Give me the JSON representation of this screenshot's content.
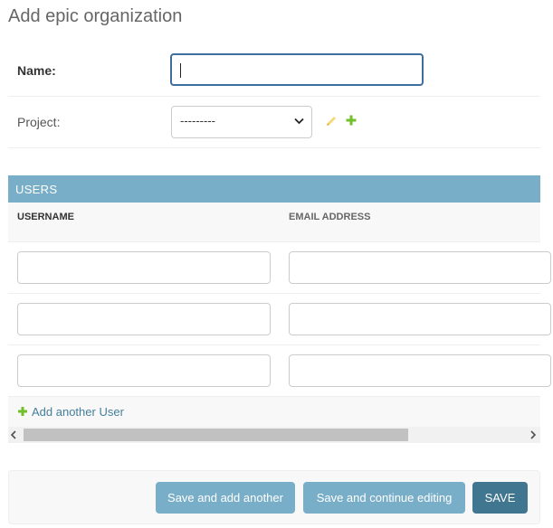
{
  "page": {
    "title": "Add epic organization"
  },
  "fields": {
    "name": {
      "label": "Name:",
      "value": ""
    },
    "project": {
      "label": "Project:",
      "selected": "---------"
    }
  },
  "inline": {
    "title": "USERS",
    "columns": [
      "USERNAME",
      "EMAIL ADDRESS"
    ],
    "rows": [
      {
        "username": "",
        "email": ""
      },
      {
        "username": "",
        "email": ""
      },
      {
        "username": "",
        "email": ""
      }
    ],
    "add_link": "Add another User"
  },
  "buttons": {
    "save_add_another": "Save and add another",
    "save_continue": "Save and continue editing",
    "save": "SAVE"
  },
  "icons": {
    "project_edit": "pencil-icon",
    "project_add": "plus-icon",
    "add_row": "plus-icon"
  },
  "colors": {
    "header_bg": "#79aec8",
    "primary_button": "#417690",
    "secondary_button": "#79aec8",
    "link": "#447e9b",
    "add_green": "#70bf2b",
    "edit_yellow": "#efb80b"
  }
}
